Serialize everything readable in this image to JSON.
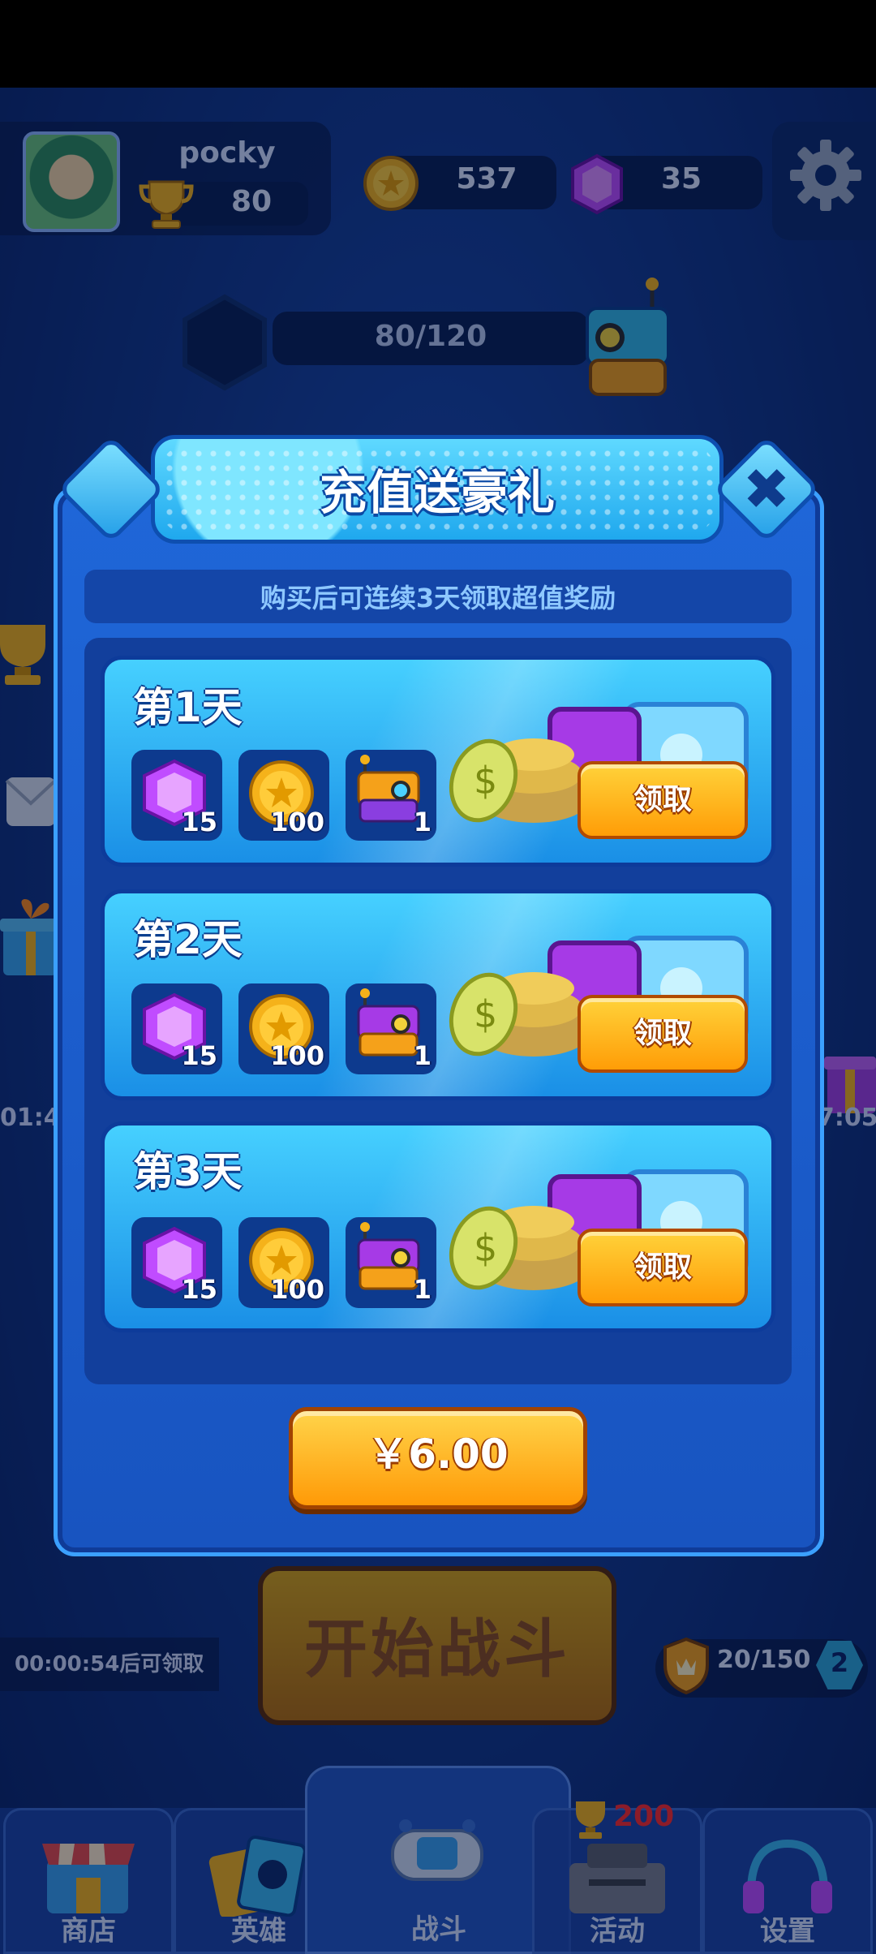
{
  "header": {
    "player_name": "pocky",
    "trophies": "80",
    "coins": "537",
    "gems": "35",
    "progress": "80/120"
  },
  "side": {
    "left_timer": "01:4",
    "right_timer": "7:05"
  },
  "bottom": {
    "claim_timer": "00:00:54后可领取",
    "start_battle": "开始战斗",
    "rank_progress": "20/150",
    "rank_level": "2"
  },
  "nav": {
    "shop": "商店",
    "heroes": "英雄",
    "battle": "战斗",
    "events": "活动",
    "settings": "设置",
    "events_trophy_count": "200"
  },
  "modal": {
    "title": "充值送豪礼",
    "subtitle": "购买后可连续3天领取超值奖励",
    "close_icon": "close-icon",
    "price": "￥6.00",
    "days": [
      {
        "title": "第1天",
        "gems": "15",
        "coins": "100",
        "chests": "1",
        "claim": "领取"
      },
      {
        "title": "第2天",
        "gems": "15",
        "coins": "100",
        "chests": "1",
        "claim": "领取"
      },
      {
        "title": "第3天",
        "gems": "15",
        "coins": "100",
        "chests": "1",
        "claim": "领取"
      }
    ]
  },
  "colors": {
    "accent_orange": "#ff9d07",
    "panel_blue": "#1f66d8",
    "header_cyan": "#5fd9ff",
    "gem_purple": "#c04cff",
    "coin_gold": "#f5b21a"
  }
}
